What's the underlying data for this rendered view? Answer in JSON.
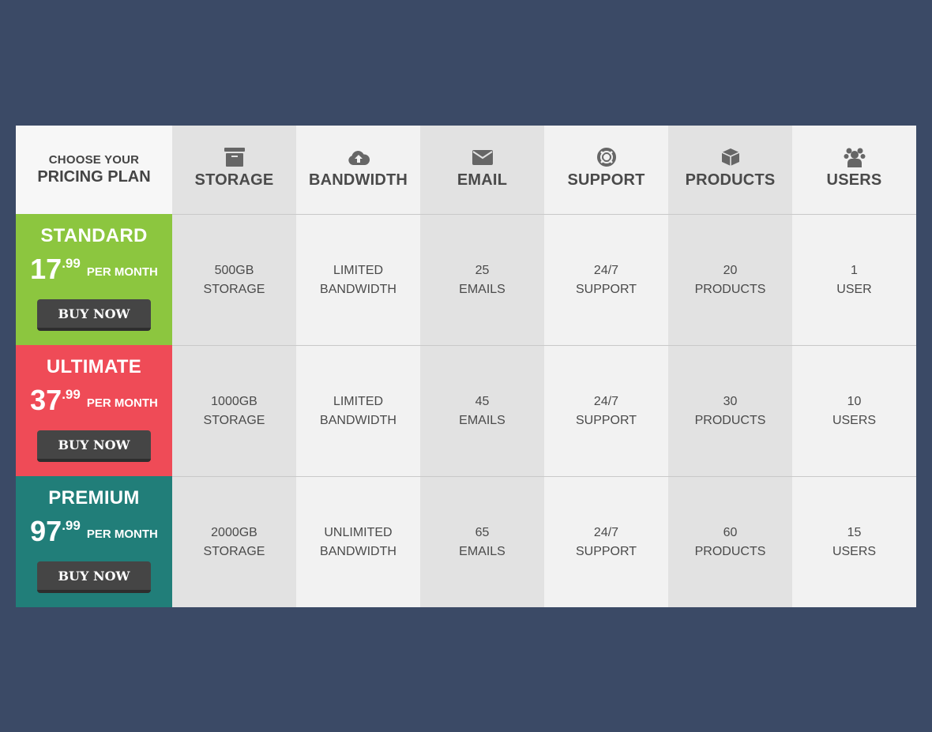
{
  "corner": {
    "line1": "CHOOSE YOUR",
    "line2": "PRICING PLAN"
  },
  "columns": [
    {
      "label": "STORAGE",
      "icon": "archive-icon"
    },
    {
      "label": "BANDWIDTH",
      "icon": "cloud-upload-icon"
    },
    {
      "label": "EMAIL",
      "icon": "envelope-icon"
    },
    {
      "label": "SUPPORT",
      "icon": "lifebuoy-icon"
    },
    {
      "label": "PRODUCTS",
      "icon": "box-icon"
    },
    {
      "label": "USERS",
      "icon": "users-icon"
    }
  ],
  "plans": [
    {
      "name": "STANDARD",
      "price_whole": "17",
      "price_cents": ".99",
      "period": "PER MONTH",
      "button": "BUY NOW",
      "color": "#8cc63f",
      "features": [
        [
          "500GB",
          "STORAGE"
        ],
        [
          "LIMITED",
          "BANDWIDTH"
        ],
        [
          "25",
          "EMAILS"
        ],
        [
          "24/7",
          "SUPPORT"
        ],
        [
          "20",
          "PRODUCTS"
        ],
        [
          "1",
          "USER"
        ]
      ]
    },
    {
      "name": "ULTIMATE",
      "price_whole": "37",
      "price_cents": ".99",
      "period": "PER MONTH",
      "button": "BUY NOW",
      "color": "#ef4b57",
      "features": [
        [
          "1000GB",
          "STORAGE"
        ],
        [
          "LIMITED",
          "BANDWIDTH"
        ],
        [
          "45",
          "EMAILS"
        ],
        [
          "24/7",
          "SUPPORT"
        ],
        [
          "30",
          "PRODUCTS"
        ],
        [
          "10",
          "USERS"
        ]
      ]
    },
    {
      "name": "PREMIUM",
      "price_whole": "97",
      "price_cents": ".99",
      "period": "PER MONTH",
      "button": "BUY NOW",
      "color": "#217e79",
      "features": [
        [
          "2000GB",
          "STORAGE"
        ],
        [
          "UNLIMITED",
          "BANDWIDTH"
        ],
        [
          "65",
          "EMAILS"
        ],
        [
          "24/7",
          "SUPPORT"
        ],
        [
          "60",
          "PRODUCTS"
        ],
        [
          "15",
          "USERS"
        ]
      ]
    }
  ]
}
